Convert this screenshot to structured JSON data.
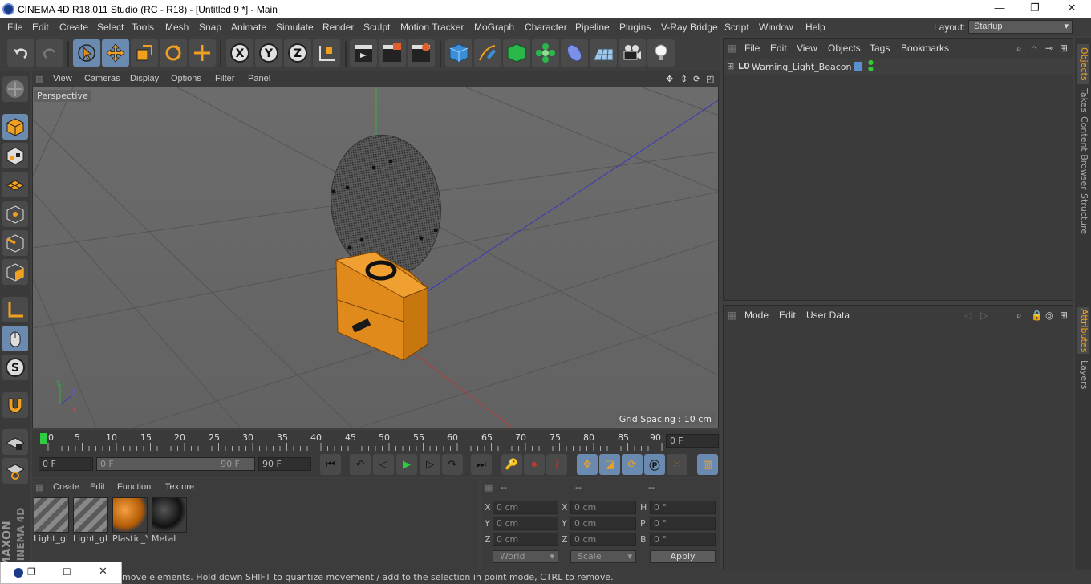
{
  "window": {
    "title": "CINEMA 4D R18.011 Studio (RC - R18) - [Untitled 9 *] - Main",
    "min": "—",
    "max": "❐",
    "close": "✕"
  },
  "menubar": {
    "items": [
      "File",
      "Edit",
      "Create",
      "Select",
      "Tools",
      "Mesh",
      "Snap",
      "Animate",
      "Simulate",
      "Render",
      "Sculpt",
      "Motion Tracker",
      "MoGraph",
      "Character",
      "Pipeline",
      "Plugins",
      "V-Ray Bridge",
      "Script",
      "Window",
      "Help"
    ],
    "layout_label": "Layout:",
    "layout_value": "Startup"
  },
  "viewport": {
    "menu": [
      "View",
      "Cameras",
      "Display",
      "Options",
      "Filter",
      "Panel"
    ],
    "label": "Perspective",
    "grid_spacing": "Grid Spacing : 10 cm"
  },
  "timeline": {
    "ticks": [
      "0",
      "5",
      "10",
      "15",
      "20",
      "25",
      "30",
      "35",
      "40",
      "45",
      "50",
      "55",
      "60",
      "65",
      "70",
      "75",
      "80",
      "85",
      "90"
    ],
    "current_frame": "0 F"
  },
  "anim": {
    "start": "0 F",
    "range_start": "0 F",
    "range_end": "90 F",
    "end": "90 F"
  },
  "material_manager": {
    "menu": [
      "Create",
      "Edit",
      "Function",
      "Texture"
    ],
    "materials": [
      {
        "name": "Light_gl"
      },
      {
        "name": "Light_gl"
      },
      {
        "name": "Plastic_Y"
      },
      {
        "name": "Metal"
      }
    ]
  },
  "coordinates": {
    "headers": [
      "--",
      "--",
      "--"
    ],
    "rows": [
      {
        "l1": "X",
        "v1": "0 cm",
        "l2": "X",
        "v2": "0 cm",
        "l3": "H",
        "v3": "0 °"
      },
      {
        "l1": "Y",
        "v1": "0 cm",
        "l2": "Y",
        "v2": "0 cm",
        "l3": "P",
        "v3": "0 °"
      },
      {
        "l1": "Z",
        "v1": "0 cm",
        "l2": "Z",
        "v2": "0 cm",
        "l3": "B",
        "v3": "0 °"
      }
    ],
    "world": "World",
    "scale": "Scale",
    "apply": "Apply"
  },
  "object_manager": {
    "menu": [
      "File",
      "Edit",
      "View",
      "Objects",
      "Tags",
      "Bookmarks"
    ],
    "objects": [
      {
        "name": "Warning_Light_Beacon"
      }
    ]
  },
  "attribute_manager": {
    "menu": [
      "Mode",
      "Edit",
      "User Data"
    ]
  },
  "right_tabs": [
    "Objects",
    "Takes",
    "Content Browser",
    "Structure",
    "Attributes",
    "Layers"
  ],
  "status": "move elements. Hold down SHIFT to quantize movement / add to the selection in point mode, CTRL to remove.",
  "brand": {
    "line1": "MAXON",
    "line2": "CINEMA 4D"
  },
  "axis": {
    "y": "Y",
    "z": "Z",
    "x": "X"
  },
  "colors": {
    "accent": "#6a8ab0",
    "object_orange": "#e08a1c",
    "play_green": "#2ecc40"
  }
}
